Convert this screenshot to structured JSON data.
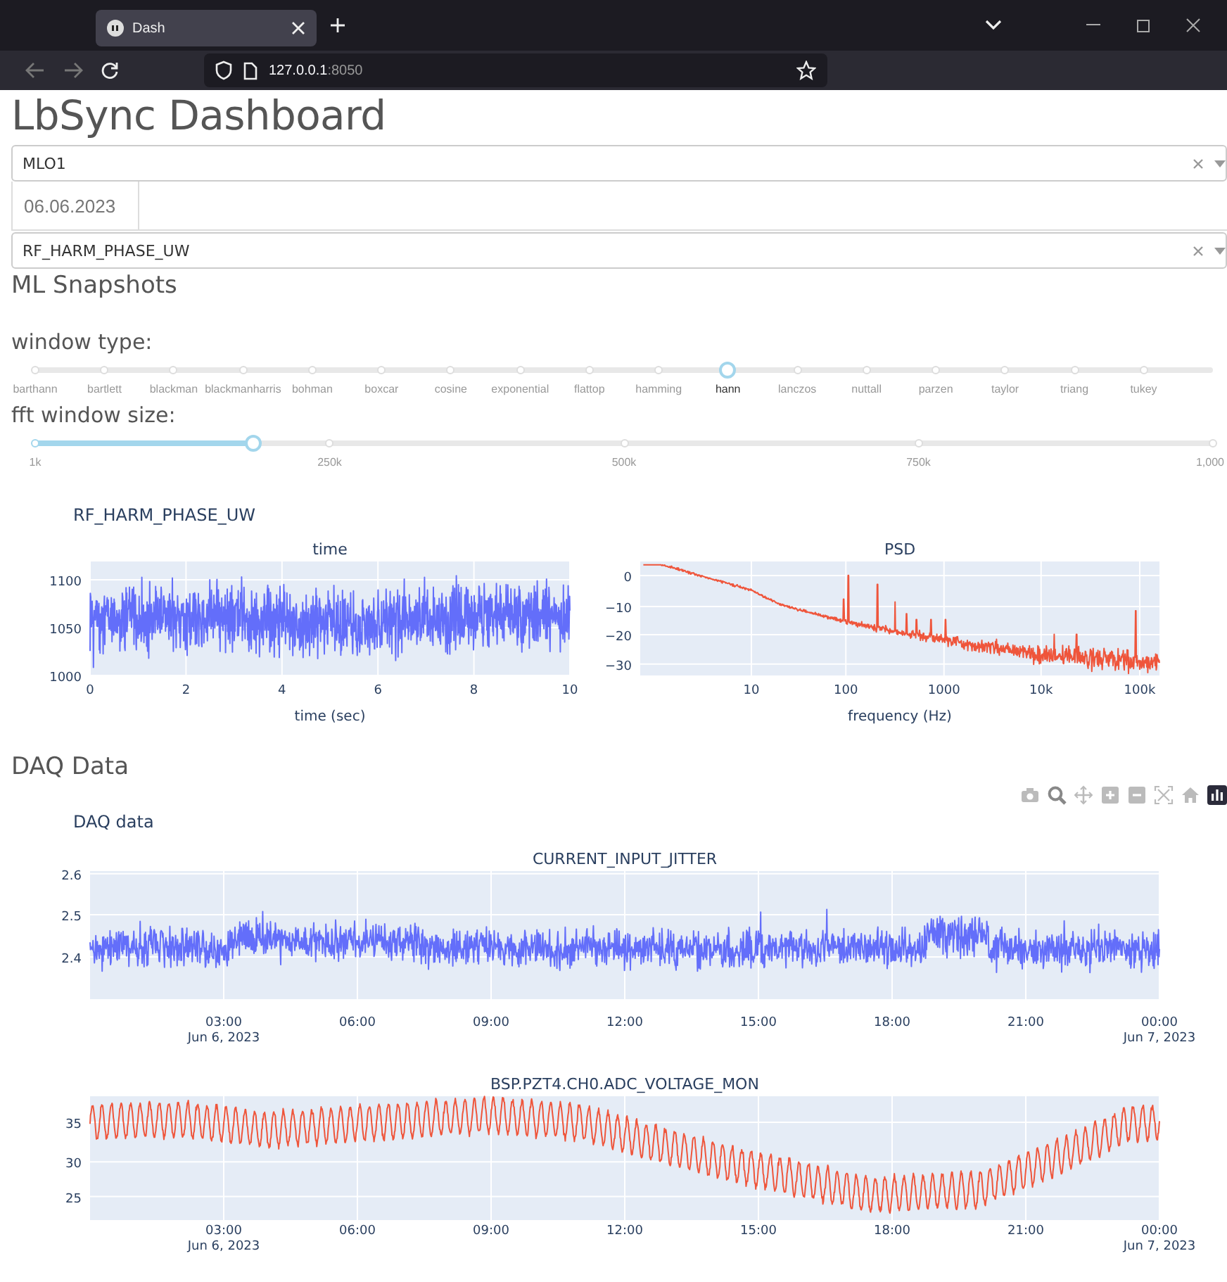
{
  "browser": {
    "tab_title": "Dash",
    "url_host": "127.0.0.1",
    "url_port": ":8050"
  },
  "title": "LbSync Dashboard",
  "controls": [
    {
      "kind": "dropdown",
      "value": "MLO1"
    },
    {
      "kind": "date",
      "value": "06.06.2023"
    },
    {
      "kind": "dropdown",
      "value": "RF_HARM_PHASE_UW"
    }
  ],
  "ml_section": {
    "heading": "ML Snapshots",
    "sliders": [
      {
        "kind": "options",
        "label": "window type:",
        "marks": [
          {
            "label": "barthann",
            "selected": false
          },
          {
            "label": "bartlett",
            "selected": false
          },
          {
            "label": "blackman",
            "selected": false
          },
          {
            "label": "blackmanharris",
            "selected": false
          },
          {
            "label": "bohman",
            "selected": false
          },
          {
            "label": "boxcar",
            "selected": false
          },
          {
            "label": "cosine",
            "selected": false
          },
          {
            "label": "exponential",
            "selected": false
          },
          {
            "label": "flattop",
            "selected": false
          },
          {
            "label": "hamming",
            "selected": false
          },
          {
            "label": "hann",
            "selected": true
          },
          {
            "label": "lanczos",
            "selected": false
          },
          {
            "label": "nuttall",
            "selected": false
          },
          {
            "label": "parzen",
            "selected": false
          },
          {
            "label": "taylor",
            "selected": false
          },
          {
            "label": "triang",
            "selected": false
          },
          {
            "label": "tukey",
            "selected": false
          }
        ]
      },
      {
        "kind": "range",
        "label": "fft window size:",
        "level": 0.185,
        "marks": [
          "1k",
          "250k",
          "500k",
          "750k",
          "1,000"
        ]
      }
    ],
    "figure": {
      "title": "RF_HARM_PHASE_UW",
      "plots": [
        {
          "kind": "time",
          "title": "time",
          "xlabel": "time (sec)",
          "yticks": [
            "1100",
            "1050",
            "1000"
          ],
          "xticks": [
            {
              "label": "0"
            },
            {
              "label": "2"
            },
            {
              "label": "4"
            },
            {
              "label": "6"
            },
            {
              "label": "8"
            },
            {
              "label": "10"
            }
          ]
        },
        {
          "kind": "psd",
          "title": "PSD",
          "xlabel": "frequency (Hz)",
          "yticks": [
            "0",
            "−10",
            "−20",
            "−30"
          ],
          "xticks": [
            {
              "label": "10"
            },
            {
              "label": "100"
            },
            {
              "label": "1000"
            },
            {
              "label": "10k"
            },
            {
              "label": "100k"
            }
          ]
        }
      ]
    }
  },
  "daq_section": {
    "heading": "DAQ Data",
    "figure": {
      "title": "DAQ data",
      "plots": [
        {
          "kind": "jitter",
          "title": "CURRENT_INPUT_JITTER",
          "yticks": [
            "2.6",
            "2.5",
            "2.4"
          ],
          "xticks": [
            {
              "label": "03:00",
              "sub": "Jun 6, 2023"
            },
            {
              "label": "06:00"
            },
            {
              "label": "09:00"
            },
            {
              "label": "12:00"
            },
            {
              "label": "15:00"
            },
            {
              "label": "18:00"
            },
            {
              "label": "21:00"
            },
            {
              "label": "00:00",
              "sub": "Jun 7, 2023"
            }
          ]
        },
        {
          "kind": "voltage",
          "title": "BSP.PZT4.CH0.ADC_VOLTAGE_MON",
          "yticks": [
            "35",
            "30",
            "25"
          ],
          "xticks": [
            {
              "label": "03:00",
              "sub": "Jun 6, 2023"
            },
            {
              "label": "06:00"
            },
            {
              "label": "09:00"
            },
            {
              "label": "12:00"
            },
            {
              "label": "15:00"
            },
            {
              "label": "18:00"
            },
            {
              "label": "21:00"
            },
            {
              "label": "00:00",
              "sub": "Jun 7, 2023"
            }
          ]
        }
      ]
    }
  }
}
